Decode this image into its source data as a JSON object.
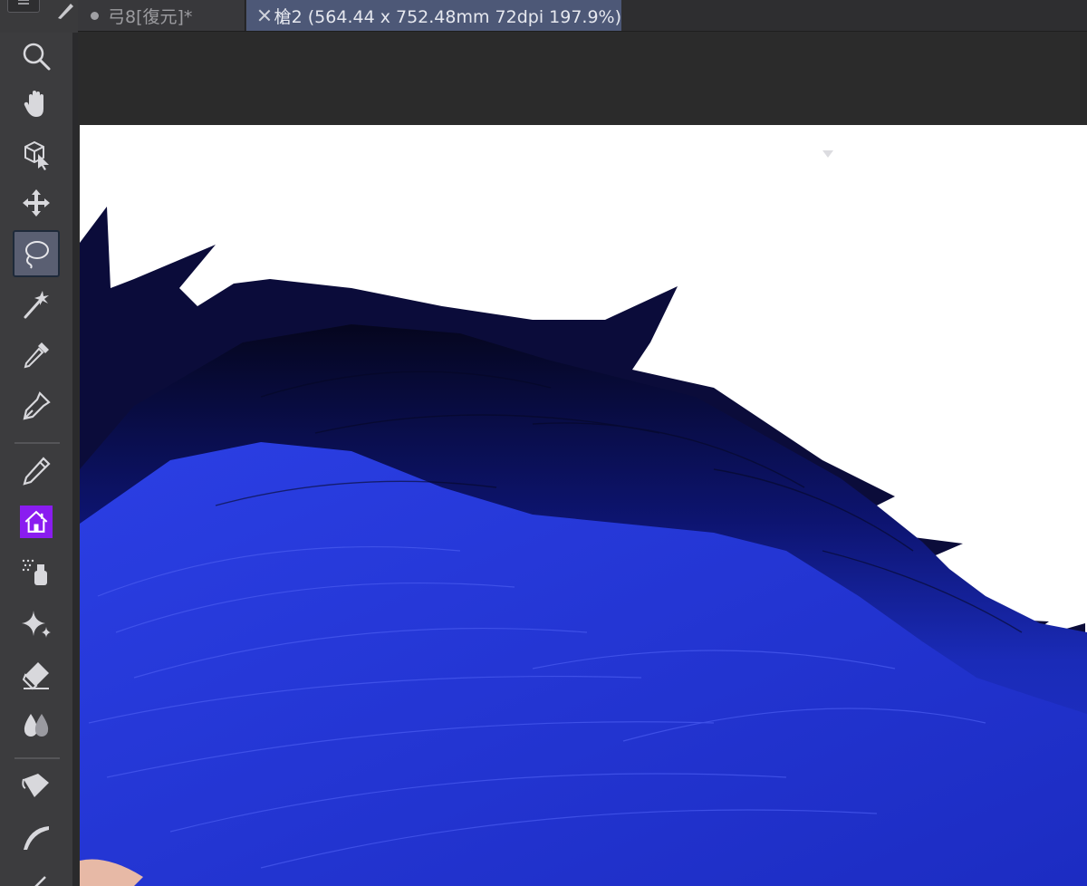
{
  "tabs": [
    {
      "label": "弓8[復元]*",
      "active": false,
      "modified": true
    },
    {
      "label": "槍2 (564.44 x 752.48mm 72dpi 197.9%)",
      "active": true
    }
  ],
  "tools": [
    {
      "name": "zoom",
      "icon": "magnifier-icon",
      "selected": false
    },
    {
      "name": "hand",
      "icon": "hand-icon",
      "selected": false
    },
    {
      "name": "operation",
      "icon": "cube-cursor-icon",
      "selected": false
    },
    {
      "name": "move-layer",
      "icon": "move-arrows-icon",
      "selected": false
    },
    {
      "name": "lasso-selection",
      "icon": "lasso-icon",
      "selected": true
    },
    {
      "name": "auto-select",
      "icon": "magic-wand-icon",
      "selected": false
    },
    {
      "name": "eyedropper",
      "icon": "eyedropper-icon",
      "selected": false
    },
    {
      "name": "pen",
      "icon": "pen-nib-icon",
      "selected": false
    },
    {
      "name": "pencil",
      "icon": "pencil-icon",
      "selected": false
    },
    {
      "name": "custom-home",
      "icon": "home-icon",
      "selected": false
    },
    {
      "name": "airbrush",
      "icon": "airbrush-icon",
      "selected": false
    },
    {
      "name": "decoration",
      "icon": "sparkle-icon",
      "selected": false
    },
    {
      "name": "eraser",
      "icon": "eraser-icon",
      "selected": false
    },
    {
      "name": "blend",
      "icon": "drops-icon",
      "selected": false
    },
    {
      "name": "fill",
      "icon": "bucket-icon",
      "selected": false
    },
    {
      "name": "gradient",
      "icon": "curve-icon",
      "selected": false
    },
    {
      "name": "figure",
      "icon": "line-icon",
      "selected": false
    }
  ],
  "colors": {
    "accent_tab": "#4d5877",
    "home_icon_bg": "#8a1cf0",
    "hair_dark": "#0a0a3a",
    "hair_mid": "#1d2fb8",
    "hair_light": "#2c40e0"
  }
}
